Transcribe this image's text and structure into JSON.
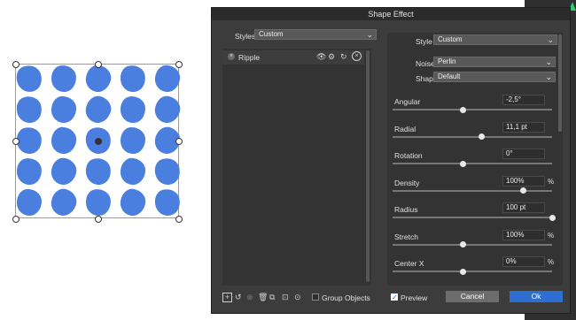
{
  "dialog": {
    "title": "Shape Effect"
  },
  "left_panel": {
    "styles_label": "Styles",
    "styles_value": "Custom",
    "effects": [
      {
        "name": "Ripple"
      }
    ]
  },
  "right_panel": {
    "style_label": "Style",
    "style_value": "Custom",
    "noise_label": "Noise",
    "noise_value": "Perlin",
    "shape_label": "Shape",
    "shape_value": "Default",
    "params": [
      {
        "label": "Angular",
        "value": "-2,5°",
        "unit": "",
        "level": 0.44
      },
      {
        "label": "Radial",
        "value": "11,1 pt",
        "unit": "",
        "level": 0.56
      },
      {
        "label": "Rotation",
        "value": "0°",
        "unit": "",
        "level": 0.44
      },
      {
        "label": "Density",
        "value": "100%",
        "unit": "%",
        "level": 0.82
      },
      {
        "label": "Radius",
        "value": "100 pt",
        "unit": "",
        "level": 1.0
      },
      {
        "label": "Stretch",
        "value": "100%",
        "unit": "%",
        "level": 0.44
      },
      {
        "label": "Center X",
        "value": "0%",
        "unit": "%",
        "level": 0.44
      }
    ]
  },
  "footer": {
    "group_objects_label": "Group Objects",
    "preview_label": "Preview",
    "cancel_label": "Cancel",
    "ok_label": "Ok"
  },
  "colors": {
    "accent": "#2d6fd0",
    "shape_fill": "#4a7fe0"
  }
}
